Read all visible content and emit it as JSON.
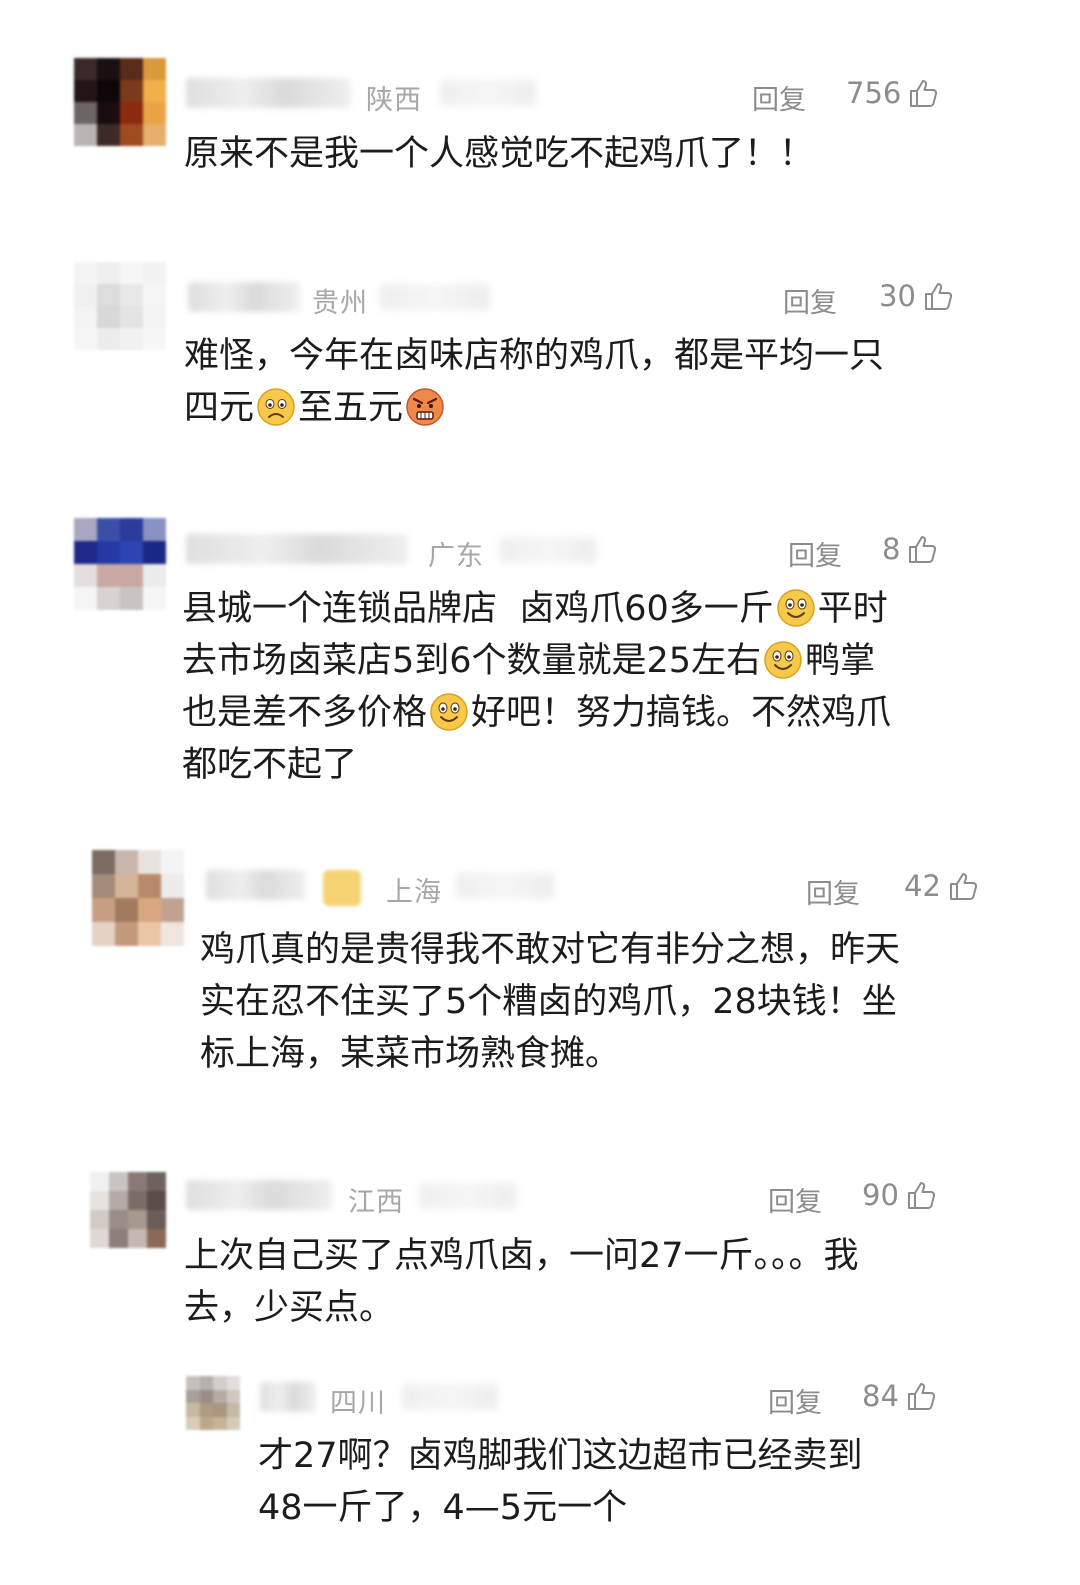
{
  "reply_label": "回复",
  "comments": [
    {
      "region": "陕西",
      "likes": "756",
      "lines": [
        "原来不是我一个人感觉吃不起鸡爪了！！"
      ]
    },
    {
      "region": "贵州",
      "likes": "30",
      "line1": "难怪，今年在卤味店称的鸡爪，都是平均一只",
      "line2_a": "四元",
      "line2_b": "至五元"
    },
    {
      "region": "广东",
      "likes": "8",
      "l1a": "县城一个连锁品牌店  卤鸡爪60多一斤",
      "l1b": "平时",
      "l2a": "去市场卤菜店5到6个数量就是25左右",
      "l2b": "鸭掌",
      "l3a": "也是差不多价格",
      "l3b": "好吧！努力搞钱。不然鸡爪",
      "l4": "都吃不起了"
    },
    {
      "region": "上海",
      "likes": "42",
      "lines": [
        "鸡爪真的是贵得我不敢对它有非分之想，昨天",
        "实在忍不住买了5个糟卤的鸡爪，28块钱！坐",
        "标上海，某菜市场熟食摊。"
      ]
    },
    {
      "region": "江西",
      "likes": "90",
      "lines": [
        "上次自己买了点鸡爪卤，一问27一斤。。。我",
        "去，少买点。"
      ]
    },
    {
      "region": "四川",
      "likes": "84",
      "lines": [
        "才27啊？卤鸡脚我们这边超市已经卖到",
        "48一斤了，4—5元一个"
      ]
    }
  ],
  "icons": {
    "like": "thumbs-up-icon",
    "smile": "smile-emoji-icon",
    "worried": "worried-emoji-icon",
    "angry": "angry-emoji-icon"
  },
  "colors": {
    "text": "#1c1c1c",
    "meta": "#8c8c8c",
    "region": "#a7a7a7",
    "emoji": "#f6c94a"
  }
}
